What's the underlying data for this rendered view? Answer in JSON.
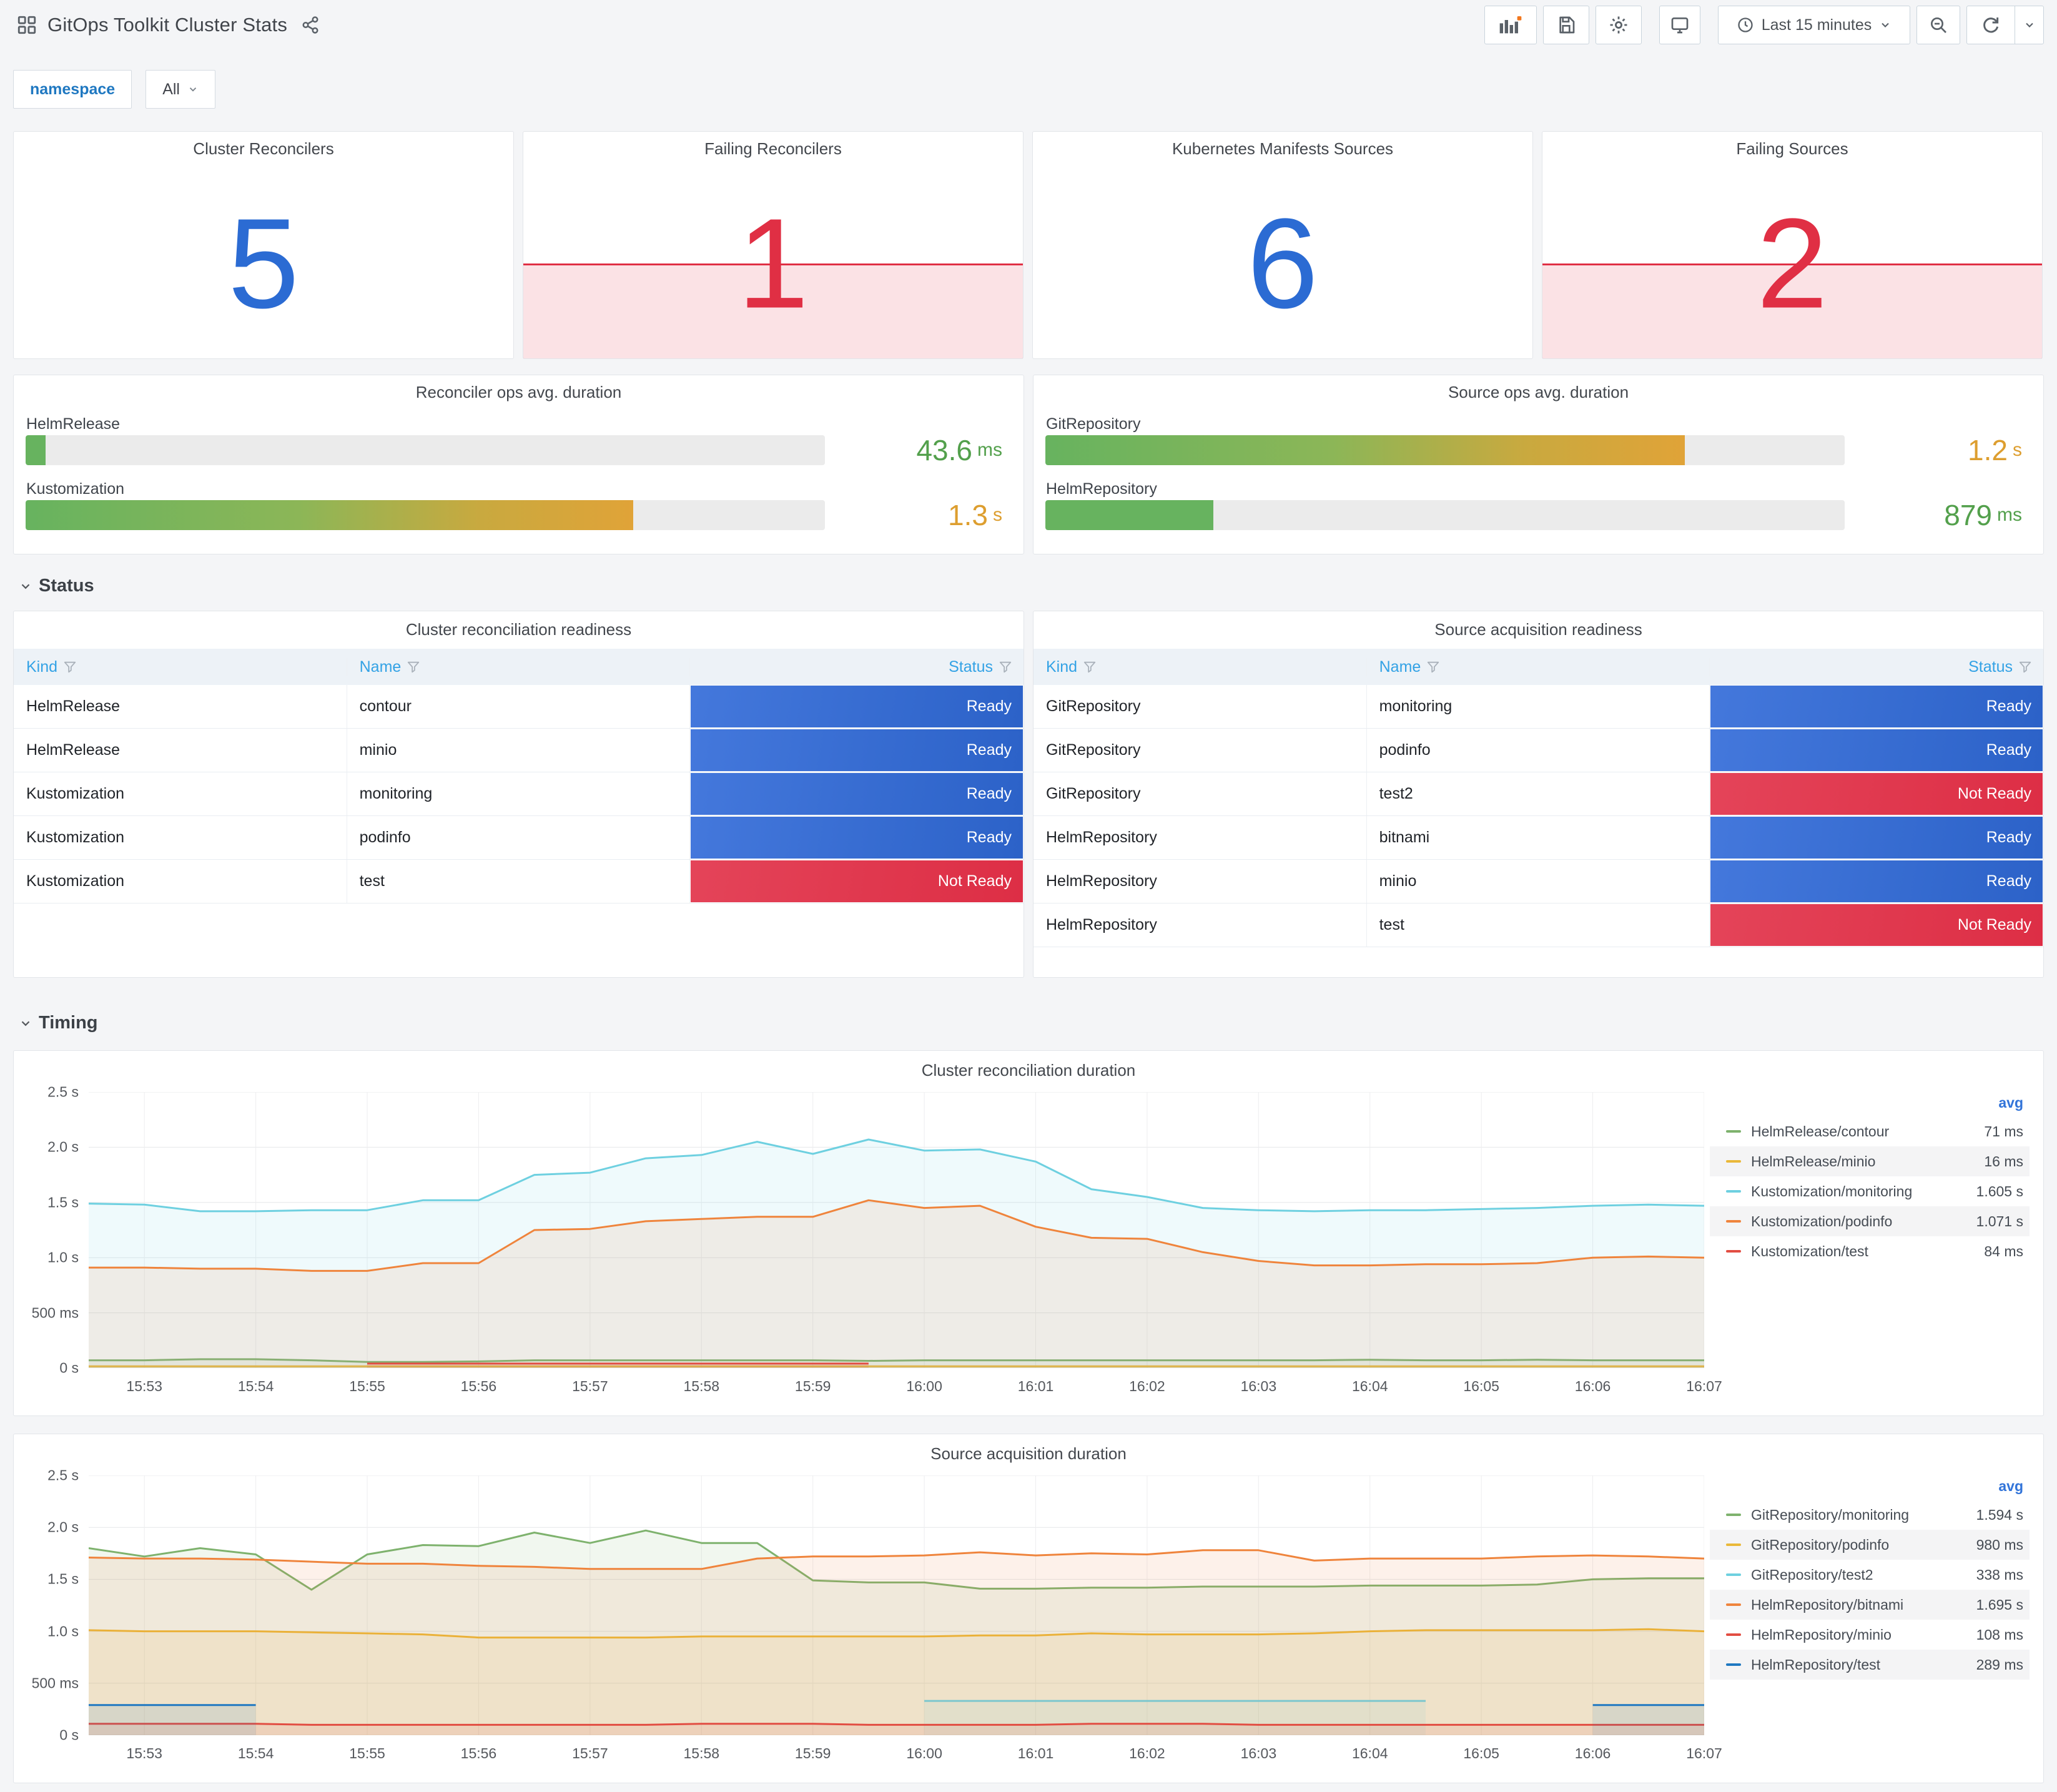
{
  "header": {
    "title": "GitOps Toolkit Cluster Stats",
    "time_picker": "Last 15 minutes",
    "icons": [
      "apps-grid-icon",
      "share-icon",
      "add-panel-icon",
      "save-icon",
      "gear-icon",
      "tv-icon",
      "clock-icon",
      "zoom-out-icon",
      "refresh-icon",
      "chevron-down-icon"
    ]
  },
  "variables": {
    "label": "namespace",
    "value": "All"
  },
  "colors": {
    "stat_ok": "#2b6bd3",
    "stat_alert": "#e02f44",
    "alert_fill": "rgba(224,47,68,0.14)",
    "green_value": "#53a04c",
    "orange_value": "#dd9e2f",
    "ready_blue": "#2f68d1",
    "notready_red": "#df3048",
    "link_blue": "#33a2e5"
  },
  "stats": [
    {
      "title": "Cluster Reconcilers",
      "value": "5",
      "state": "ok"
    },
    {
      "title": "Failing Reconcilers",
      "value": "1",
      "state": "alert"
    },
    {
      "title": "Kubernetes Manifests Sources",
      "value": "6",
      "state": "ok"
    },
    {
      "title": "Failing Sources",
      "value": "2",
      "state": "alert"
    }
  ],
  "gauges": [
    {
      "title": "Reconciler ops avg. duration",
      "rows": [
        {
          "label": "HelmRelease",
          "value": "43.6",
          "unit": "ms",
          "percent": 2.5,
          "tone": "green"
        },
        {
          "label": "Kustomization",
          "value": "1.3",
          "unit": "s",
          "percent": 76,
          "tone": "orange"
        }
      ]
    },
    {
      "title": "Source ops avg. duration",
      "rows": [
        {
          "label": "GitRepository",
          "value": "1.2",
          "unit": "s",
          "percent": 80,
          "tone": "orange"
        },
        {
          "label": "HelmRepository",
          "value": "879",
          "unit": "ms",
          "percent": 21,
          "tone": "green"
        }
      ]
    }
  ],
  "sections": {
    "status": "Status",
    "timing": "Timing"
  },
  "tables": [
    {
      "title": "Cluster reconciliation readiness",
      "columns": [
        "Kind",
        "Name",
        "Status"
      ],
      "rows": [
        {
          "kind": "HelmRelease",
          "name": "contour",
          "status": "Ready"
        },
        {
          "kind": "HelmRelease",
          "name": "minio",
          "status": "Ready"
        },
        {
          "kind": "Kustomization",
          "name": "monitoring",
          "status": "Ready"
        },
        {
          "kind": "Kustomization",
          "name": "podinfo",
          "status": "Ready"
        },
        {
          "kind": "Kustomization",
          "name": "test",
          "status": "Not Ready"
        }
      ]
    },
    {
      "title": "Source acquisition readiness",
      "columns": [
        "Kind",
        "Name",
        "Status"
      ],
      "rows": [
        {
          "kind": "GitRepository",
          "name": "monitoring",
          "status": "Ready"
        },
        {
          "kind": "GitRepository",
          "name": "podinfo",
          "status": "Ready"
        },
        {
          "kind": "GitRepository",
          "name": "test2",
          "status": "Not Ready"
        },
        {
          "kind": "HelmRepository",
          "name": "bitnami",
          "status": "Ready"
        },
        {
          "kind": "HelmRepository",
          "name": "minio",
          "status": "Ready"
        },
        {
          "kind": "HelmRepository",
          "name": "test",
          "status": "Not Ready"
        }
      ]
    }
  ],
  "chart_data": [
    {
      "type": "line",
      "title": "Cluster reconciliation duration",
      "legend_header": "avg",
      "x_start_label": "15:52:30",
      "x_step_minutes": 0.5,
      "x_max_minutes": 14.5,
      "x_tick_labels": [
        "15:53",
        "15:54",
        "15:55",
        "15:56",
        "15:57",
        "15:58",
        "15:59",
        "16:00",
        "16:01",
        "16:02",
        "16:03",
        "16:04",
        "16:05",
        "16:06",
        "16:07"
      ],
      "y_ticks": [
        {
          "v": 0,
          "label": "0 s"
        },
        {
          "v": 0.5,
          "label": "500 ms"
        },
        {
          "v": 1.0,
          "label": "1.0 s"
        },
        {
          "v": 1.5,
          "label": "1.5 s"
        },
        {
          "v": 2.0,
          "label": "2.0 s"
        },
        {
          "v": 2.5,
          "label": "2.5 s"
        }
      ],
      "ylim": [
        0,
        2.5
      ],
      "unit": "seconds",
      "legend_position": "right",
      "series": [
        {
          "name": "HelmRelease/contour",
          "avg": "71 ms",
          "color": "#7EB26D",
          "values": [
            0.07,
            0.07,
            0.08,
            0.08,
            0.07,
            0.055,
            0.055,
            0.06,
            0.07,
            0.07,
            0.07,
            0.07,
            0.07,
            0.07,
            0.065,
            0.07,
            0.07,
            0.07,
            0.07,
            0.07,
            0.07,
            0.07,
            0.07,
            0.075,
            0.07,
            0.07,
            0.075,
            0.07,
            0.07,
            0.07
          ]
        },
        {
          "name": "HelmRelease/minio",
          "avg": "16 ms",
          "color": "#EAB839",
          "values": [
            0.016,
            0.016,
            0.016,
            0.016,
            0.016,
            0.016,
            0.016,
            0.016,
            0.016,
            0.016,
            0.016,
            0.016,
            0.016,
            0.016,
            0.016,
            0.016,
            0.016,
            0.016,
            0.016,
            0.016,
            0.016,
            0.016,
            0.016,
            0.016,
            0.016,
            0.016,
            0.016,
            0.016,
            0.016,
            0.016
          ]
        },
        {
          "name": "Kustomization/monitoring",
          "avg": "1.605 s",
          "color": "#6ED0E0",
          "values": [
            1.49,
            1.48,
            1.42,
            1.42,
            1.43,
            1.43,
            1.52,
            1.52,
            1.75,
            1.77,
            1.9,
            1.93,
            2.05,
            1.94,
            2.07,
            1.97,
            1.98,
            1.87,
            1.62,
            1.55,
            1.45,
            1.43,
            1.42,
            1.43,
            1.43,
            1.44,
            1.45,
            1.47,
            1.48,
            1.47
          ]
        },
        {
          "name": "Kustomization/podinfo",
          "avg": "1.071 s",
          "color": "#EF843C",
          "values": [
            0.91,
            0.91,
            0.9,
            0.9,
            0.88,
            0.88,
            0.95,
            0.95,
            1.25,
            1.26,
            1.33,
            1.35,
            1.37,
            1.37,
            1.52,
            1.45,
            1.47,
            1.28,
            1.18,
            1.17,
            1.05,
            0.97,
            0.93,
            0.93,
            0.94,
            0.94,
            0.95,
            1.0,
            1.01,
            1.0
          ]
        },
        {
          "name": "Kustomization/test",
          "avg": "84 ms",
          "color": "#E24D42",
          "values": [
            null,
            null,
            null,
            null,
            null,
            0.04,
            0.04,
            0.04,
            0.04,
            0.04,
            0.04,
            0.04,
            0.04,
            0.04,
            0.04,
            null,
            null,
            null,
            null,
            null,
            null,
            null,
            null,
            null,
            null,
            null,
            null,
            null,
            null,
            null
          ]
        }
      ]
    },
    {
      "type": "line",
      "title": "Source acquisition duration",
      "legend_header": "avg",
      "x_start_label": "15:52:30",
      "x_step_minutes": 0.5,
      "x_max_minutes": 14.5,
      "x_tick_labels": [
        "15:53",
        "15:54",
        "15:55",
        "15:56",
        "15:57",
        "15:58",
        "15:59",
        "16:00",
        "16:01",
        "16:02",
        "16:03",
        "16:04",
        "16:05",
        "16:06",
        "16:07"
      ],
      "y_ticks": [
        {
          "v": 0,
          "label": "0 s"
        },
        {
          "v": 0.5,
          "label": "500 ms"
        },
        {
          "v": 1.0,
          "label": "1.0 s"
        },
        {
          "v": 1.5,
          "label": "1.5 s"
        },
        {
          "v": 2.0,
          "label": "2.0 s"
        },
        {
          "v": 2.5,
          "label": "2.5 s"
        }
      ],
      "ylim": [
        0,
        2.5
      ],
      "unit": "seconds",
      "legend_position": "right",
      "series": [
        {
          "name": "GitRepository/monitoring",
          "avg": "1.594 s",
          "color": "#7EB26D",
          "values": [
            1.8,
            1.72,
            1.8,
            1.74,
            1.4,
            1.74,
            1.83,
            1.82,
            1.95,
            1.85,
            1.97,
            1.85,
            1.85,
            1.49,
            1.47,
            1.47,
            1.41,
            1.41,
            1.42,
            1.42,
            1.43,
            1.43,
            1.43,
            1.44,
            1.44,
            1.44,
            1.45,
            1.5,
            1.51,
            1.51
          ]
        },
        {
          "name": "GitRepository/podinfo",
          "avg": "980 ms",
          "color": "#EAB839",
          "values": [
            1.01,
            1.0,
            1.0,
            1.0,
            0.99,
            0.98,
            0.97,
            0.94,
            0.94,
            0.94,
            0.94,
            0.95,
            0.95,
            0.95,
            0.95,
            0.95,
            0.96,
            0.96,
            0.98,
            0.97,
            0.97,
            0.97,
            0.98,
            1.0,
            1.01,
            1.01,
            1.01,
            1.01,
            1.02,
            1.0
          ]
        },
        {
          "name": "GitRepository/test2",
          "avg": "338 ms",
          "color": "#6ED0E0",
          "values": [
            null,
            null,
            null,
            null,
            null,
            null,
            null,
            null,
            null,
            null,
            null,
            null,
            null,
            null,
            null,
            0.33,
            0.33,
            0.33,
            0.33,
            0.33,
            0.33,
            0.33,
            0.33,
            0.33,
            0.33,
            null,
            null,
            null,
            null,
            null
          ]
        },
        {
          "name": "HelmRepository/bitnami",
          "avg": "1.695 s",
          "color": "#EF843C",
          "values": [
            1.71,
            1.7,
            1.7,
            1.69,
            1.67,
            1.65,
            1.65,
            1.63,
            1.62,
            1.6,
            1.6,
            1.6,
            1.7,
            1.72,
            1.72,
            1.73,
            1.76,
            1.73,
            1.75,
            1.74,
            1.78,
            1.78,
            1.68,
            1.7,
            1.7,
            1.7,
            1.72,
            1.73,
            1.72,
            1.7
          ]
        },
        {
          "name": "HelmRepository/minio",
          "avg": "108 ms",
          "color": "#E24D42",
          "values": [
            0.11,
            0.11,
            0.11,
            0.11,
            0.1,
            0.1,
            0.1,
            0.1,
            0.1,
            0.1,
            0.1,
            0.11,
            0.11,
            0.11,
            0.1,
            0.1,
            0.1,
            0.1,
            0.11,
            0.11,
            0.11,
            0.1,
            0.1,
            0.1,
            0.1,
            0.1,
            0.1,
            0.1,
            0.1,
            0.1
          ]
        },
        {
          "name": "HelmRepository/test",
          "avg": "289 ms",
          "color": "#1F78C1",
          "values": [
            0.29,
            0.29,
            0.29,
            0.29,
            null,
            null,
            null,
            null,
            null,
            null,
            null,
            null,
            null,
            null,
            null,
            null,
            null,
            null,
            null,
            null,
            null,
            null,
            null,
            null,
            null,
            null,
            null,
            0.29,
            0.29,
            0.29
          ]
        }
      ]
    }
  ]
}
